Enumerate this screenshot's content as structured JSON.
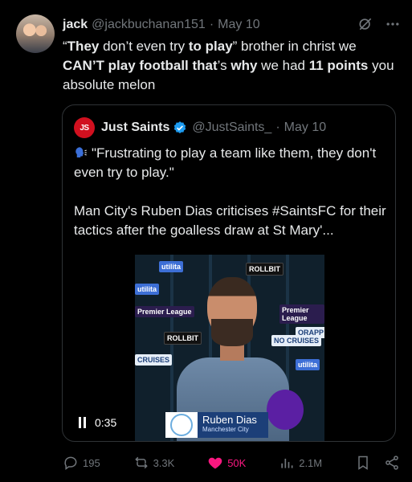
{
  "tweet": {
    "name": "jack",
    "handle": "@jackbuchanan151",
    "separator": "·",
    "date": "May 10",
    "text": [
      {
        "t": "“",
        "b": false
      },
      {
        "t": "They",
        "b": true
      },
      {
        "t": " don’t even try ",
        "b": false
      },
      {
        "t": "to play",
        "b": true
      },
      {
        "t": "” brother in christ we ",
        "b": false
      },
      {
        "t": "CAN’T play football that",
        "b": true
      },
      {
        "t": "’s ",
        "b": false
      },
      {
        "t": "why",
        "b": true
      },
      {
        "t": " we had ",
        "b": false
      },
      {
        "t": "11 points",
        "b": true
      },
      {
        "t": " you absolute melon",
        "b": false
      }
    ]
  },
  "quote": {
    "logo_text": "JS",
    "name": "Just Saints",
    "handle": "@JustSaints_",
    "separator": "·",
    "date": "May 10",
    "line1": "\"Frustrating to play a team like them, they don't even try to play.\"",
    "line2": "Man City's Ruben Dias criticises #SaintsFC for their tactics after the goalless draw at St Mary'..."
  },
  "video": {
    "time": "0:35",
    "lower_third_name": "Ruben Dias",
    "lower_third_club": "Manchester City",
    "board_tiles": [
      "utilita",
      "utilita",
      "ROLLBIT",
      "ROLLBIT",
      "Premier League",
      "Premier League",
      "CRUISES",
      "ORAPP",
      "utilita",
      "NO CRUISES"
    ]
  },
  "actions": {
    "replies": "195",
    "reposts": "3.3K",
    "likes": "50K",
    "views": "2.1M"
  },
  "colors": {
    "like": "#f91880",
    "muted": "#71767b",
    "text": "#e7e9ea",
    "verified": "#1d9bf0"
  }
}
